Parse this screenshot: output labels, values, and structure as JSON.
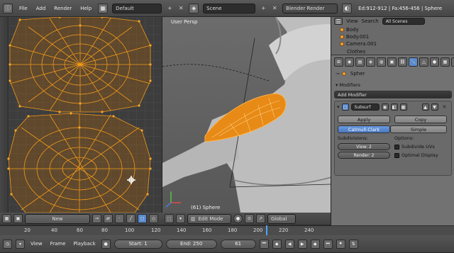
{
  "topbar": {
    "menus": [
      "File",
      "Add",
      "Render",
      "Help"
    ],
    "layout": "Default",
    "scene": "Scene",
    "engine": "Blender Render",
    "stats": "Ed:912-912 | Fa:456-456 | Sphere"
  },
  "viewport": {
    "view_name": "User Persp",
    "object_label": "(61) Sphere"
  },
  "outliner": {
    "view_label": "View",
    "search_label": "Search",
    "filter": "All Scenes",
    "items": [
      "Body",
      "Body.001",
      "Camera.001",
      "Clothes"
    ]
  },
  "properties": {
    "object_name": "Spher",
    "modifiers_header": "Modifiers",
    "add_modifier": "Add Modifier",
    "modifier_name": "Subsurf",
    "apply_label": "Apply",
    "copy_label": "Copy",
    "catmull_label": "Catmull-Clark",
    "simple_label": "Simple",
    "subdivisions_label": "Subdivisions:",
    "options_label": "Options:",
    "view_field": "View: 2",
    "render_field": "Render: 2",
    "subdivide_uvs": "Subdivide UVs",
    "optimal_display": "Optimal Display"
  },
  "uv_footer": {
    "new_label": "New"
  },
  "view3d_footer": {
    "mode": "Edit Mode",
    "orientation": "Global"
  },
  "timeline": {
    "ticks": [
      "20",
      "40",
      "60",
      "80",
      "100",
      "120",
      "140",
      "160",
      "180",
      "200",
      "220",
      "240"
    ],
    "menus": [
      "View",
      "Frame",
      "Playback"
    ],
    "start": "Start: 1",
    "end": "End: 250",
    "current": "61"
  },
  "colors": {
    "uv_mesh": "#f39a1a",
    "active_button": "#5b8ad0",
    "viewport_bg": "#646464"
  }
}
